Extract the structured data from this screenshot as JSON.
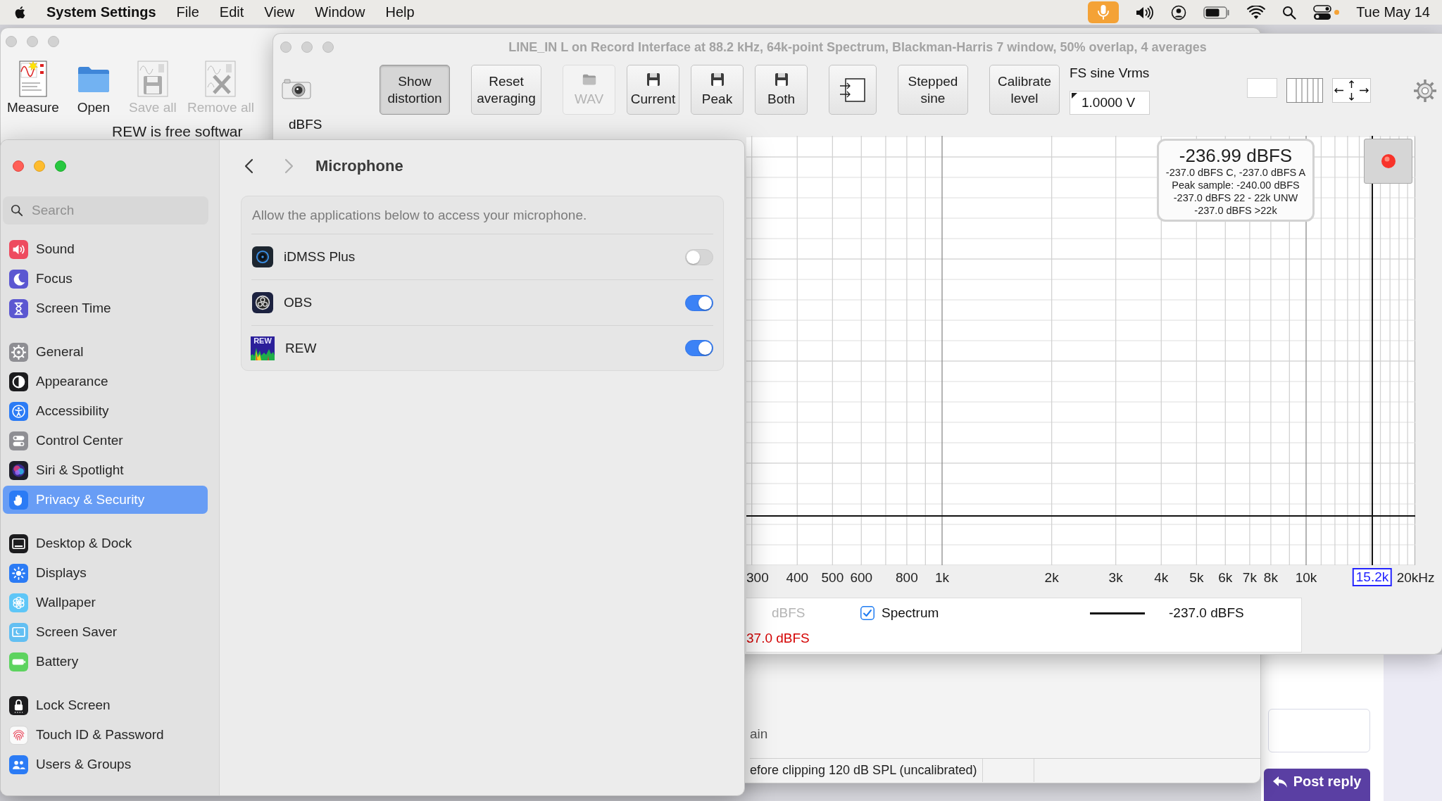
{
  "menu_bar": {
    "app_name": "System Settings",
    "menus": [
      "File",
      "Edit",
      "View",
      "Window",
      "Help"
    ],
    "mic_in_use": true,
    "clock": "Tue May 14"
  },
  "rew_main_window": {
    "toolbar": [
      {
        "label": "Measure",
        "disabled": false
      },
      {
        "label": "Open",
        "disabled": false
      },
      {
        "label": "Save all",
        "disabled": true
      },
      {
        "label": "Remove all",
        "disabled": true
      }
    ],
    "intro_text": "REW is free softwar",
    "gain_label": "ain",
    "status_cells": [
      "efore clipping 120 dB SPL (uncalibrated)"
    ]
  },
  "rta_window": {
    "title": "LINE_IN L on Record Interface at 88.2 kHz, 64k-point Spectrum, Blackman-Harris 7 window, 50% overlap, 4 averages",
    "y_unit": "dBFS",
    "buttons": [
      {
        "kind": "text",
        "label": "Show distortion",
        "pressed": true,
        "disabled": false
      },
      {
        "kind": "text",
        "label": "Reset averaging",
        "pressed": false,
        "disabled": false
      },
      {
        "kind": "folder",
        "label": "WAV",
        "pressed": false,
        "disabled": true
      },
      {
        "kind": "save",
        "label": "Current",
        "pressed": false,
        "disabled": false
      },
      {
        "kind": "save",
        "label": "Peak",
        "pressed": false,
        "disabled": false
      },
      {
        "kind": "save",
        "label": "Both",
        "pressed": false,
        "disabled": false
      },
      {
        "kind": "icon",
        "pressed": false,
        "disabled": false
      },
      {
        "kind": "text",
        "label": "Stepped sine",
        "pressed": false,
        "disabled": false
      },
      {
        "kind": "text",
        "label": "Calibrate level",
        "pressed": false,
        "disabled": false
      }
    ],
    "fs_sine": {
      "label": "FS sine Vrms",
      "value": "1.0000 V"
    },
    "readout": {
      "level": "-236.99 dBFS",
      "details": [
        "-237.0 dBFS C, -237.0 dBFS A",
        "Peak sample: -240.00 dBFS",
        "-237.0 dBFS 22 - 22k UNW",
        "-237.0 dBFS >22k"
      ]
    },
    "recording": true,
    "x_axis_labels": [
      "300",
      "400",
      "500",
      "600",
      "800",
      "1k",
      "2k",
      "3k",
      "4k",
      "5k",
      "6k",
      "7k",
      "8k",
      "10k",
      "20kHz"
    ],
    "cursor_label": "15.2k",
    "legend": {
      "header": "dBFS",
      "series": [
        {
          "name": "Spectrum",
          "checked": true,
          "value": "-237.0 dBFS"
        }
      ],
      "overall": "37.0 dBFS"
    }
  },
  "settings_window": {
    "search": {
      "placeholder": "Search"
    },
    "sidebar": {
      "groups": [
        {
          "items": [
            {
              "label": "Sound",
              "selected": false
            },
            {
              "label": "Focus",
              "selected": false
            },
            {
              "label": "Screen Time",
              "selected": false
            }
          ]
        },
        {
          "items": [
            {
              "label": "General",
              "selected": false
            },
            {
              "label": "Appearance",
              "selected": false
            },
            {
              "label": "Accessibility",
              "selected": false
            },
            {
              "label": "Control Center",
              "selected": false
            },
            {
              "label": "Siri & Spotlight",
              "selected": false
            },
            {
              "label": "Privacy & Security",
              "selected": true
            }
          ]
        },
        {
          "items": [
            {
              "label": "Desktop & Dock",
              "selected": false
            },
            {
              "label": "Displays",
              "selected": false
            },
            {
              "label": "Wallpaper",
              "selected": false
            },
            {
              "label": "Screen Saver",
              "selected": false
            },
            {
              "label": "Battery",
              "selected": false
            }
          ]
        },
        {
          "items": [
            {
              "label": "Lock Screen",
              "selected": false
            },
            {
              "label": "Touch ID & Password",
              "selected": false
            },
            {
              "label": "Users & Groups",
              "selected": false
            }
          ]
        }
      ]
    },
    "page": {
      "title": "Microphone",
      "back_enabled": true,
      "forward_enabled": false,
      "description": "Allow the applications below to access your microphone.",
      "apps": [
        {
          "name": "iDMSS Plus",
          "on": false
        },
        {
          "name": "OBS",
          "on": true
        },
        {
          "name": "REW",
          "on": true,
          "icon_text": "REW"
        }
      ]
    }
  },
  "web_page": {
    "reply_button": "Post reply"
  }
}
